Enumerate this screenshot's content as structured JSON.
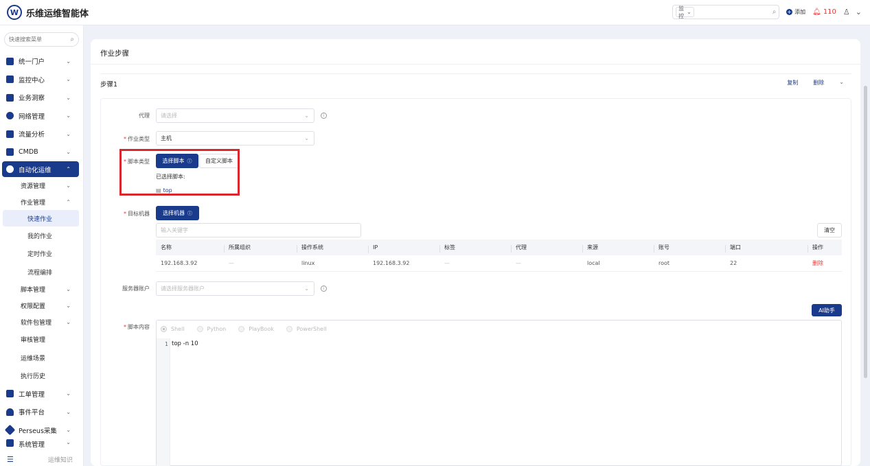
{
  "header": {
    "logo_letter": "W",
    "app_title": "乐维运维智能体",
    "search_scope": "监控",
    "search_placeholder": "",
    "add_label": "添加",
    "alert_count": "110"
  },
  "sidebar": {
    "search_placeholder": "快速搜索菜单",
    "items": [
      {
        "label": "统一门户"
      },
      {
        "label": "监控中心"
      },
      {
        "label": "业务洞察"
      },
      {
        "label": "网络管理"
      },
      {
        "label": "流量分析"
      },
      {
        "label": "CMDB"
      },
      {
        "label": "自动化运维"
      },
      {
        "label": "工单管理"
      },
      {
        "label": "事件平台"
      },
      {
        "label": "Perseus采集"
      },
      {
        "label": "系统管理"
      }
    ],
    "sub_items": {
      "resource": "资源管理",
      "job_mgmt": "作业管理",
      "quick_job": "快速作业",
      "my_jobs": "我的作业",
      "scheduled_jobs": "定时作业",
      "flow_edit": "流程编排",
      "script_mgmt": "脚本管理",
      "permissions": "权限配置",
      "software": "软件包管理",
      "audit": "审核管理",
      "scenes": "运维场景",
      "history": "执行历史"
    },
    "footer_label": "运维知识"
  },
  "main": {
    "title": "作业步骤",
    "step_label": "步骤1",
    "copy_label": "复制",
    "delete_label": "删除"
  },
  "form": {
    "proxy_label": "代理",
    "proxy_placeholder": "请选择",
    "job_type_label": "作业类型",
    "job_type_value": "主机",
    "script_type_label": "脚本类型",
    "select_script_btn": "选择脚本",
    "custom_script_btn": "自定义脚本",
    "selected_script_label": "已选择脚本:",
    "selected_script_name": "top",
    "target_label": "目标机器",
    "select_machine_btn": "选择机器",
    "keyword_placeholder": "输入关键字",
    "clear_btn": "清空",
    "server_account_label": "服务器账户",
    "server_account_placeholder": "请选择服务器账户",
    "ai_btn": "AI助手",
    "script_content_label": "脚本内容"
  },
  "table": {
    "headers": [
      "名称",
      "所属组织",
      "操作系统",
      "IP",
      "标签",
      "代理",
      "来源",
      "账号",
      "端口",
      "操作"
    ],
    "rows": [
      {
        "name": "192.168.3.92",
        "org": "—",
        "os": "linux",
        "ip": "192.168.3.92",
        "tag": "—",
        "proxy": "—",
        "source": "local",
        "account": "root",
        "port": "22",
        "action": "删除"
      }
    ]
  },
  "editor": {
    "languages": [
      "Shell",
      "Python",
      "PlayBook",
      "PowerShell"
    ],
    "selected_language": "Shell",
    "line_number": "1",
    "code": "top -n 10"
  },
  "colors": {
    "primary": "#1a3b8c",
    "danger": "#e33333",
    "highlight_box": "#d9272e"
  }
}
